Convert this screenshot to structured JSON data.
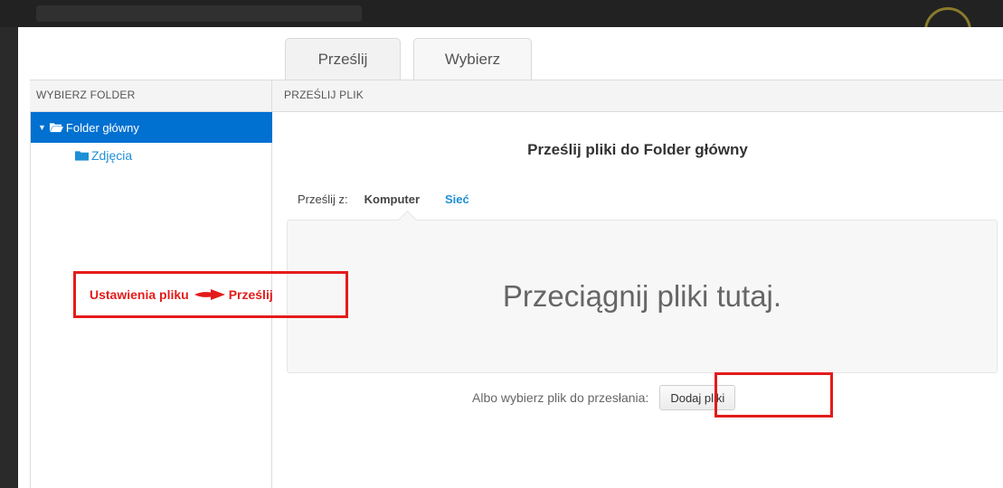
{
  "tabs": [
    {
      "label": "Prześlij",
      "active": true
    },
    {
      "label": "Wybierz",
      "active": false
    }
  ],
  "sidebar": {
    "header": "WYBIERZ FOLDER",
    "tree": {
      "root": {
        "label": "Folder główny",
        "expanded": true,
        "selected": true
      },
      "children": [
        {
          "label": "Zdjęcia"
        }
      ]
    }
  },
  "upload": {
    "header": "PRZEŚLIJ PLIK",
    "title": "Prześlij pliki do Folder główny",
    "source_label": "Prześlij z:",
    "sources": [
      {
        "label": "Komputer",
        "active": true
      },
      {
        "label": "Sieć",
        "active": false
      }
    ],
    "dropzone_text": "Przeciągnij pliki tutaj.",
    "choose_label": "Albo wybierz plik do przesłania:",
    "add_button": "Dodaj pliki"
  },
  "annotation": {
    "settings_text": "Ustawienia pliku",
    "target_text": "Prześlij"
  },
  "colors": {
    "selected_bg": "#0070d1",
    "link": "#1e8fd6",
    "annotation": "#e41b1b"
  }
}
